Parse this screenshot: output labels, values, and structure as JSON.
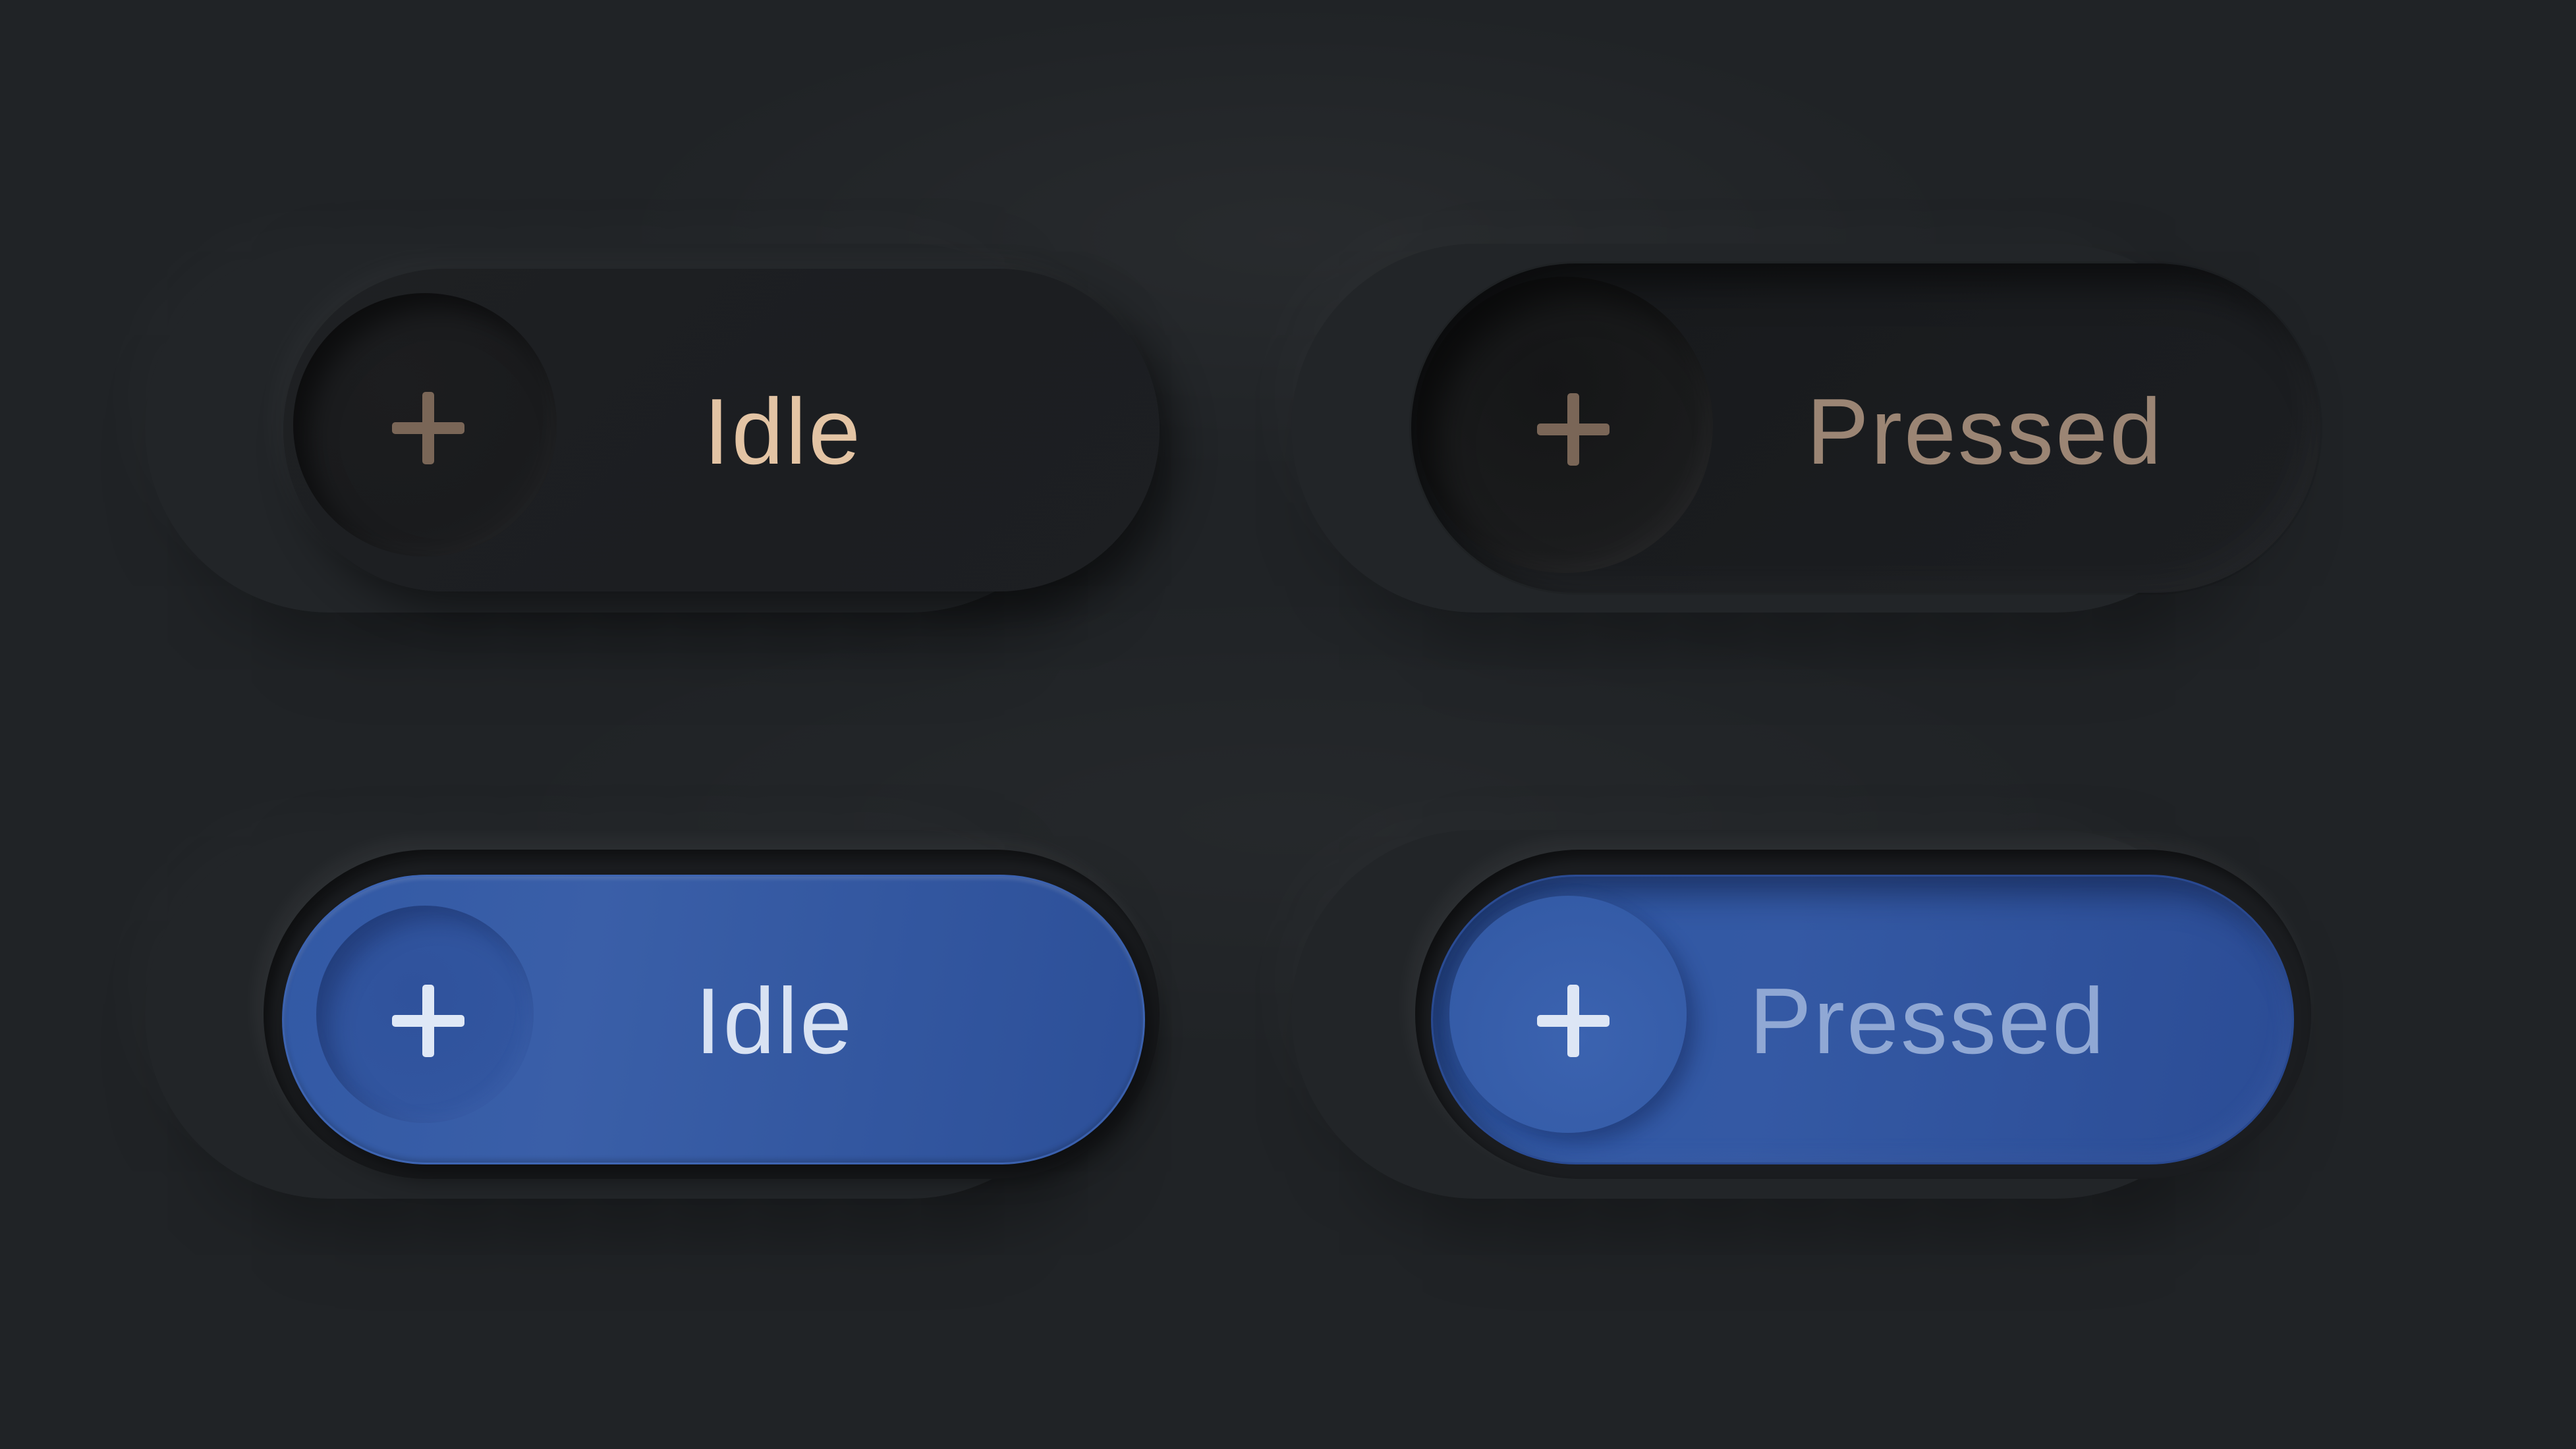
{
  "buttons": {
    "dark_idle": {
      "label": "Idle",
      "state": "idle",
      "theme": "dark",
      "icon": "plus-icon"
    },
    "dark_pressed": {
      "label": "Pressed",
      "state": "pressed",
      "theme": "dark",
      "icon": "plus-icon"
    },
    "blue_idle": {
      "label": "Idle",
      "state": "idle",
      "theme": "blue",
      "icon": "plus-icon"
    },
    "blue_pressed": {
      "label": "Pressed",
      "state": "pressed",
      "theme": "blue",
      "icon": "plus-icon"
    }
  },
  "colors": {
    "background": "#202326",
    "dark_button": "#1d1f22",
    "blue_button": "#3259a5",
    "dark_idle_text": "#e3c4a4",
    "dark_pressed_text": "#9b8574",
    "dark_icon": "#7a6657",
    "blue_idle_text": "#d8e2f3",
    "blue_pressed_text": "#90a8d4"
  }
}
